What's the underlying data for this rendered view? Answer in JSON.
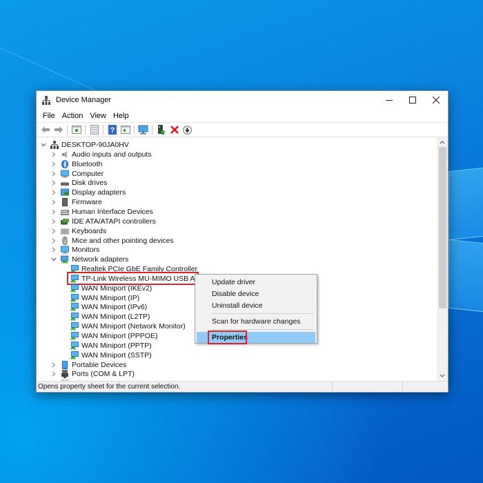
{
  "window": {
    "title": "Device Manager",
    "caption_buttons": {
      "minimize": "minimize",
      "maximize": "maximize",
      "close": "close"
    }
  },
  "menubar": {
    "items": [
      {
        "label": "File"
      },
      {
        "label": "Action"
      },
      {
        "label": "View"
      },
      {
        "label": "Help"
      }
    ]
  },
  "toolbar": {
    "buttons": [
      {
        "icon": "back-arrow-icon",
        "tooltip": "Back"
      },
      {
        "icon": "forward-arrow-icon",
        "tooltip": "Forward"
      },
      {
        "icon": "show-hide-console-tree-icon",
        "tooltip": "Show/Hide Console Tree"
      },
      {
        "icon": "properties-sheet-icon",
        "tooltip": "Properties"
      },
      {
        "icon": "help-icon",
        "tooltip": "Help"
      },
      {
        "icon": "show-action-pane-icon",
        "tooltip": "Show Action Pane"
      },
      {
        "icon": "scan-hardware-icon",
        "tooltip": "Scan for hardware changes"
      },
      {
        "icon": "update-driver-icon",
        "tooltip": "Update driver"
      },
      {
        "icon": "uninstall-device-icon",
        "tooltip": "Uninstall device"
      },
      {
        "icon": "disable-device-icon",
        "tooltip": "Disable device"
      }
    ]
  },
  "tree": {
    "root": {
      "label": "DESKTOP-90JA0HV",
      "expanded": true,
      "icon": "computer-tree-icon"
    },
    "categories": [
      {
        "label": "Audio inputs and outputs",
        "icon": "speaker-icon",
        "expanded": false
      },
      {
        "label": "Bluetooth",
        "icon": "bluetooth-icon",
        "expanded": false
      },
      {
        "label": "Computer",
        "icon": "monitor-icon",
        "expanded": false
      },
      {
        "label": "Disk drives",
        "icon": "disk-drive-icon",
        "expanded": false
      },
      {
        "label": "Display adapters",
        "icon": "display-adapter-icon",
        "expanded": false
      },
      {
        "label": "Firmware",
        "icon": "firmware-icon",
        "expanded": false
      },
      {
        "label": "Human Interface Devices",
        "icon": "hid-icon",
        "expanded": false
      },
      {
        "label": "IDE ATA/ATAPI controllers",
        "icon": "ide-controller-icon",
        "expanded": false
      },
      {
        "label": "Keyboards",
        "icon": "keyboard-icon",
        "expanded": false
      },
      {
        "label": "Mice and other pointing devices",
        "icon": "mouse-icon",
        "expanded": false
      },
      {
        "label": "Monitors",
        "icon": "monitor-icon",
        "expanded": false
      },
      {
        "label": "Network adapters",
        "icon": "network-adapter-icon",
        "expanded": true,
        "children": [
          {
            "label": "Realtek PCIe GbE Family Controller"
          },
          {
            "label": "TP-Link Wireless MU-MIMO USB Adapter",
            "selected": true
          },
          {
            "label": "WAN Miniport (IKEv2)"
          },
          {
            "label": "WAN Miniport (IP)"
          },
          {
            "label": "WAN Miniport (IPv6)"
          },
          {
            "label": "WAN Miniport (L2TP)"
          },
          {
            "label": "WAN Miniport (Network Monitor)"
          },
          {
            "label": "WAN Miniport (PPPOE)"
          },
          {
            "label": "WAN Miniport (PPTP)"
          },
          {
            "label": "WAN Miniport (SSTP)"
          }
        ]
      },
      {
        "label": "Portable Devices",
        "icon": "portable-device-icon",
        "expanded": false
      },
      {
        "label": "Ports (COM & LPT)",
        "icon": "port-icon",
        "expanded": false
      },
      {
        "label": "Print queues",
        "icon": "printer-icon",
        "expanded": false
      }
    ]
  },
  "context_menu": {
    "items": [
      {
        "label": "Update driver"
      },
      {
        "label": "Disable device"
      },
      {
        "label": "Uninstall device"
      },
      {
        "separator": true
      },
      {
        "label": "Scan for hardware changes"
      },
      {
        "separator": true
      },
      {
        "label": "Properties",
        "active": true
      }
    ]
  },
  "scrollbar": {
    "position_fraction": 0.0,
    "visible_fraction": 0.72
  },
  "statusbar": {
    "text": "Opens property sheet for the current selection."
  },
  "colors": {
    "highlight_border": "#d9232d",
    "menu_active": "#91c9f7",
    "desktop_blue": "#0771d6"
  }
}
